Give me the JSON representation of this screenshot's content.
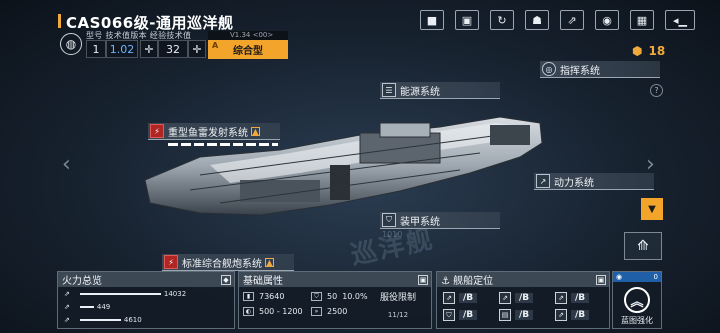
{
  "ship": {
    "title": "CAS066级-通用巡洋舰",
    "labels": "型号 技术值版本 经验技术值",
    "model_no": "1",
    "tech_version": "1.02",
    "exp_tech": "32",
    "version_tag": "V1.34 <00>",
    "type": "综合型",
    "type_grade": "A",
    "currency": "18",
    "watermark": "巡洋舰",
    "watermark_num": "1010"
  },
  "top_icons": [
    "camera-icon",
    "image-icon",
    "refresh-icon",
    "robot-icon",
    "external-link-icon",
    "view-icon",
    "grid-icon",
    "back-icon"
  ],
  "systems": {
    "command": "指挥系统",
    "energy": "能源系统",
    "torpedo": "重型鱼雷发射系统",
    "power": "动力系统",
    "armor": "装甲系统",
    "cannon": "标准综合舰炮系统"
  },
  "firepower": {
    "title": "火力总览",
    "rows": [
      {
        "value": "14032",
        "fill": 0.9
      },
      {
        "value": "449",
        "fill": 0.15
      },
      {
        "value": "4610",
        "fill": 0.45
      }
    ]
  },
  "attributes": {
    "title": "基础属性",
    "hp": "73640",
    "shield": "50",
    "shield_pct": "10.0%",
    "range": "500 - 1200",
    "speed": "2500",
    "service_label": "服役限制",
    "service_count": "11/12"
  },
  "positioning": {
    "title": "舰船定位",
    "cells": [
      "/B",
      "/B",
      "/B",
      "/B",
      "/B",
      "/B"
    ]
  },
  "blueprint": {
    "label": "蓝图强化",
    "count": "0"
  },
  "colors": {
    "accent": "#f3a52b",
    "bg": "#17222f",
    "danger": "#b02624"
  }
}
